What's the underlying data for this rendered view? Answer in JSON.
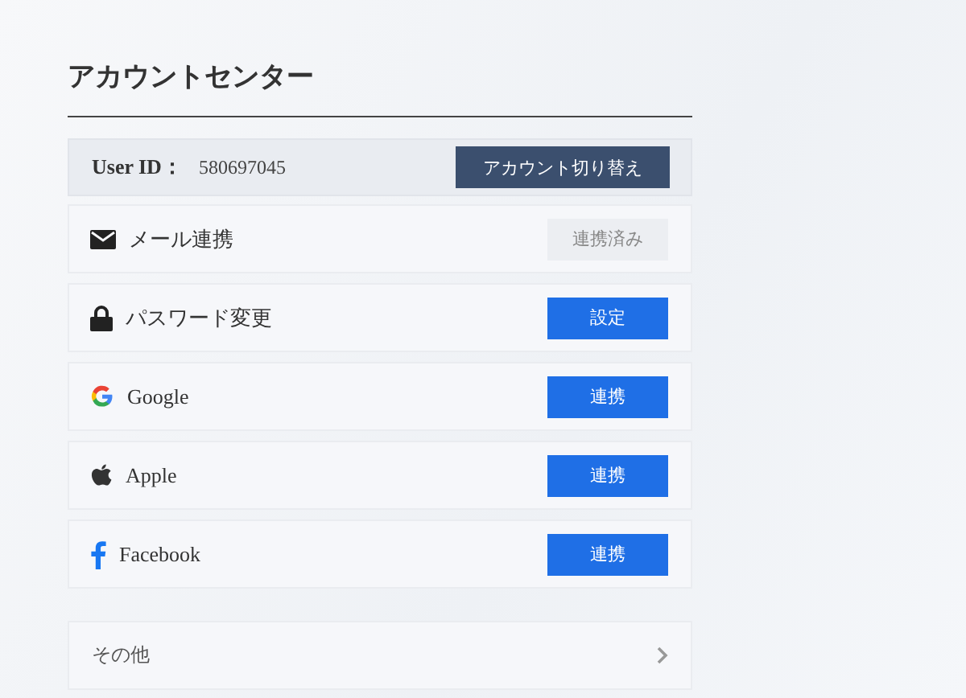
{
  "title": "アカウントセンター",
  "user": {
    "label": "User ID：",
    "id": "580697045",
    "button": "アカウント切り替え"
  },
  "services": [
    {
      "kind": "mail",
      "label": "メール連携",
      "button": "連携済み",
      "linked": true
    },
    {
      "kind": "lock",
      "label": "パスワード変更",
      "button": "設定",
      "linked": false
    },
    {
      "kind": "google",
      "label": "Google",
      "button": "連携",
      "linked": false
    },
    {
      "kind": "apple",
      "label": "Apple",
      "button": "連携",
      "linked": false
    },
    {
      "kind": "facebook",
      "label": "Facebook",
      "button": "連携",
      "linked": false
    }
  ],
  "other": {
    "label": "その他"
  }
}
